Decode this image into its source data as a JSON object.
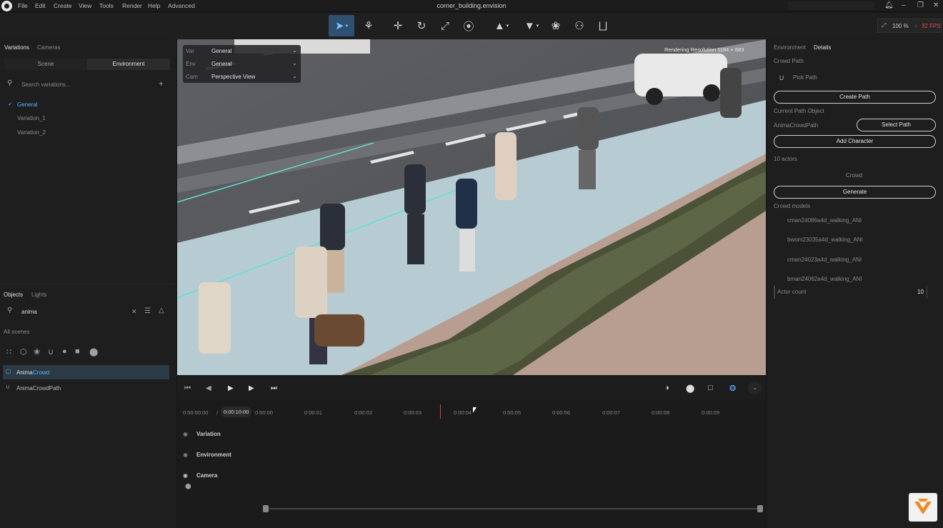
{
  "app": {
    "title": "corner_building.envision"
  },
  "menu": [
    "File",
    "Edit",
    "Create",
    "View",
    "Tools",
    "Render",
    "Help",
    "Advanced"
  ],
  "toolbar": {
    "zoom": "100 %",
    "fps": "32 FPS"
  },
  "left": {
    "top_tabs": [
      "Variations",
      "Cameras"
    ],
    "segment": [
      "Scene",
      "Environment"
    ],
    "search_placeholder": "Search variations...",
    "variations": [
      "General",
      "Variation_1",
      "Variation_2"
    ],
    "bottom_tabs": [
      "Objects",
      "Lights"
    ],
    "object_search": "anima",
    "scope": "All scenes",
    "objects": [
      {
        "prefix": "Anima",
        "suffix": "Crowd"
      },
      {
        "prefix": "AnimaCrowdPath",
        "suffix": ""
      }
    ]
  },
  "viewport": {
    "rendering_resolution": "Rendering Resolution  1184 × 683",
    "overlay": [
      {
        "key": "Var",
        "value": "General"
      },
      {
        "key": "Env",
        "value": "General"
      },
      {
        "key": "Cam",
        "value": "Perspective View"
      }
    ]
  },
  "timeline": {
    "current": "0:00:00:00",
    "sep": "/",
    "total": "0:00:10:00",
    "ticks": [
      "0:00:00",
      "0:00:01",
      "0:00:02",
      "0:00:03",
      "0:00:04",
      "0:00:05",
      "0:00:06",
      "0:00:07",
      "0:00:08",
      "0:00:09"
    ],
    "tracks": [
      "Variation",
      "Environment",
      "Camera"
    ]
  },
  "right": {
    "tabs": [
      "Environment",
      "Details"
    ],
    "crowd_path": "Crowd Path",
    "pick_path": "Pick Path",
    "create_path": "Create Path",
    "current_path_object": "Current Path Object",
    "path_object_value": "AnimaCrowdPath",
    "select_path": "Select Path",
    "add_character": "Add Character",
    "actors": "10 actors",
    "crowd": "Crowd",
    "generate": "Generate",
    "crowd_models": "Crowd models",
    "models": [
      "cman24086a4d_walking_ANI",
      "bwom23035a4d_walking_ANI",
      "cman24023a4d_walking_ANI",
      "bman24062a4d_walking_ANI"
    ],
    "actor_count_label": "Actor count",
    "actor_count_value": "10"
  }
}
